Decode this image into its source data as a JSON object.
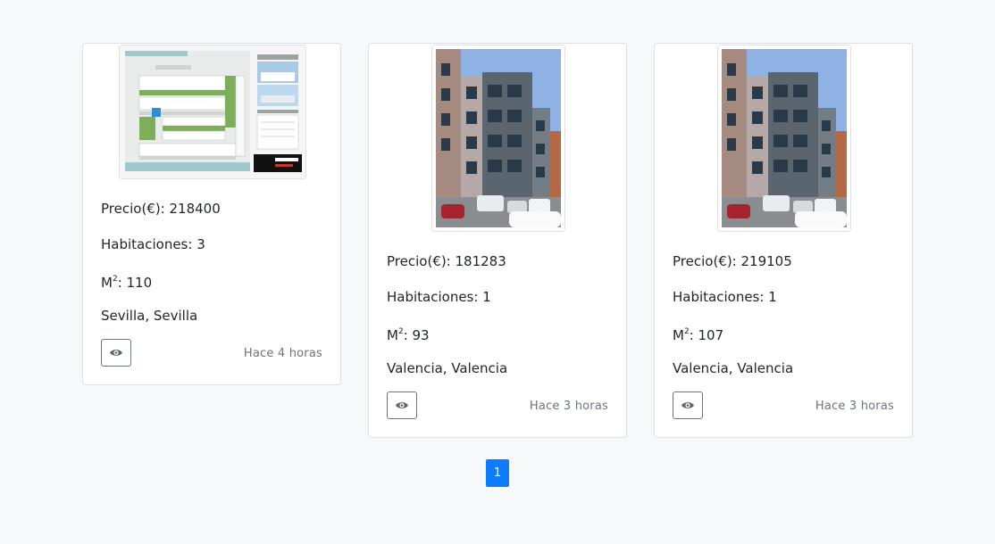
{
  "listings": [
    {
      "price_label": "Precio(€): 218400",
      "rooms_label": "Habitaciones: 3",
      "area_prefix": "M",
      "area_sup": "2",
      "area_value": ": 110",
      "location": "Sevilla, Sevilla",
      "time_ago": "Hace 4 horas",
      "image": "site-plan-image",
      "view_icon": "eye-icon"
    },
    {
      "price_label": "Precio(€): 181283",
      "rooms_label": "Habitaciones: 1",
      "area_prefix": "M",
      "area_sup": "2",
      "area_value": ": 93",
      "location": "Valencia, Valencia",
      "time_ago": "Hace 3 horas",
      "image": "building-photo",
      "view_icon": "eye-icon"
    },
    {
      "price_label": "Precio(€): 219105",
      "rooms_label": "Habitaciones: 1",
      "area_prefix": "M",
      "area_sup": "2",
      "area_value": ": 107",
      "location": "Valencia, Valencia",
      "time_ago": "Hace 3 horas",
      "image": "building-photo",
      "view_icon": "eye-icon"
    }
  ],
  "pagination": {
    "current_page": "1"
  },
  "colors": {
    "background": "#f7f8fa",
    "pager_active": "#0d7bfe",
    "button_border": "#6c757d"
  }
}
